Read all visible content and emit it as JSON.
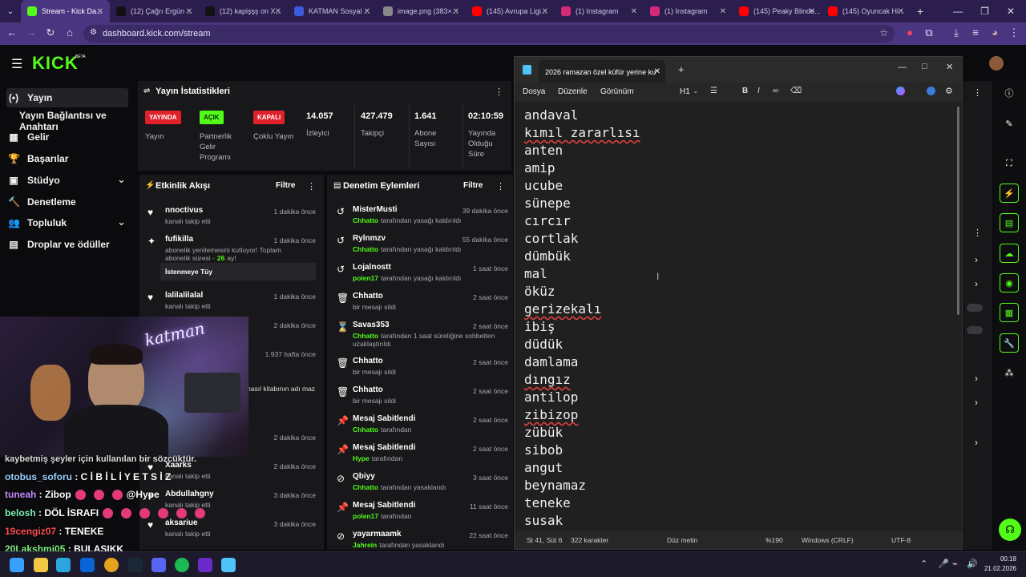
{
  "browser": {
    "tabs": [
      {
        "label": "Stream - Kick Da...",
        "fav": "#53fc18",
        "active": true
      },
      {
        "label": "(12) Çağrı Ergün ...",
        "fav": "#111111"
      },
      {
        "label": "(12) kapişşş on X...",
        "fav": "#111111"
      },
      {
        "label": "KATMAN Sosyal ...",
        "fav": "#3b5bdb"
      },
      {
        "label": "image.png (383×...",
        "fav": "#888888"
      },
      {
        "label": "(145) Avrupa Ligi...",
        "fav": "#ff0000"
      },
      {
        "label": "(1) Instagram",
        "fav": "#d62976"
      },
      {
        "label": "(1) Instagram",
        "fav": "#d62976"
      },
      {
        "label": "(145) Peaky Blinde...",
        "fav": "#ff0000"
      },
      {
        "label": "(145) Oyuncak Hi...",
        "fav": "#ff0000"
      }
    ],
    "new_tab": "+",
    "url": "dashboard.kick.com/stream"
  },
  "kick": {
    "logo": "KICK",
    "logo_beta": "BETA",
    "nav": [
      {
        "label": "Yayın",
        "icon": "(•)",
        "active": true
      },
      {
        "label": "Yayın Bağlantısı ve Anahtarı",
        "icon": ""
      },
      {
        "label": "Gelir",
        "icon": "▦"
      },
      {
        "label": "Başarılar",
        "icon": "🏆"
      },
      {
        "label": "Stüdyo",
        "icon": "▣",
        "chevron": "⌄"
      },
      {
        "label": "Denetleme",
        "icon": "🔨"
      },
      {
        "label": "Topluluk",
        "icon": "👥",
        "chevron": "⌄"
      },
      {
        "label": "Droplar ve ödüller",
        "icon": "▤"
      }
    ],
    "stats": {
      "title": "Yayın İstatistikleri",
      "badges": [
        {
          "value": "YAYINDA",
          "label": "Yayın",
          "color": "#e0202a"
        },
        {
          "value": "AÇIK",
          "label": "Partnerlik Gelir Programı",
          "color": "#53fc18"
        },
        {
          "value": "KAPALI",
          "label": "Çoklu Yayın",
          "color": "#e0202a"
        }
      ],
      "numbers": [
        {
          "value": "14.057",
          "label": "İzleyici"
        },
        {
          "value": "427.479",
          "label": "Takipçi"
        },
        {
          "value": "1.641",
          "label": "Abone Sayısı"
        },
        {
          "value": "02:10:59",
          "label": "Yayında Olduğu Süre"
        }
      ]
    },
    "activity": {
      "title": "Etkinlik Akışı",
      "filter": "Filtre",
      "items": [
        {
          "name": "nnoctivus",
          "sub": "kanalı takip etti",
          "time": "1 dakika önce"
        },
        {
          "name": "fufikilla",
          "sub": "abonelik yenilemesini kutluyor! Toplam abonelik süresi -",
          "months": "26",
          "months_suffix": "ay!",
          "message": "İstenmeye Tüy",
          "time": "1 dakika önce"
        },
        {
          "name": "lalilalilalal",
          "sub": "kanalı takip etti",
          "time": "1 dakika önce"
        },
        {
          "time": "2 dakika önce"
        },
        {
          "time": "1.937 hafta önce",
          "sub": "nasıl kitabının adı maz"
        },
        {
          "time": "2 dakika önce"
        },
        {
          "name": "Xaarks",
          "sub": "kanalı takip etti",
          "time": "2 dakika önce"
        },
        {
          "name": "Abdullahgny",
          "sub": "kanalı takip etti",
          "time": "3 dakika önce"
        },
        {
          "name": "aksariue",
          "sub": "kanalı takip etti",
          "time": "3 dakika önce"
        }
      ]
    },
    "moderation": {
      "title": "Denetim Eylemleri",
      "filter": "Filtre",
      "items": [
        {
          "icon": "↺",
          "name": "MisterMusti",
          "actor": "Chhatto",
          "sub": "tarafından yasağı kaldırıldı",
          "time": "39 dakika önce"
        },
        {
          "icon": "↺",
          "name": "Rylnmzv",
          "actor": "Chhatto",
          "sub": "tarafından yasağı kaldırıldı",
          "time": "55 dakika önce"
        },
        {
          "icon": "↺",
          "name": "Lojalnostt",
          "actor": "polen17",
          "sub": "tarafından yasağı kaldırıldı",
          "time": "1 saat önce"
        },
        {
          "icon": "🗑",
          "name": "Chhatto",
          "actor": "",
          "sub": "bir mesajı sildi",
          "time": "2 saat önce"
        },
        {
          "icon": "⌛",
          "name": "Savas353",
          "actor": "Chhatto",
          "sub": "tarafından 1 saat süreliğine sohbetten uzaklaştırıldı",
          "time": "2 saat önce"
        },
        {
          "icon": "🗑",
          "name": "Chhatto",
          "actor": "",
          "sub": "bir mesajı sildi",
          "time": "2 saat önce"
        },
        {
          "icon": "🗑",
          "name": "Chhatto",
          "actor": "",
          "sub": "bir mesajı sildi",
          "time": "2 saat önce"
        },
        {
          "icon": "📌",
          "name": "Mesaj Sabitlendi",
          "actor": "Chhatto",
          "sub": "tarafından",
          "time": "2 saat önce"
        },
        {
          "icon": "📌",
          "name": "Mesaj Sabitlendi",
          "actor": "Hype",
          "sub": "tarafından",
          "time": "2 saat önce"
        },
        {
          "icon": "⊘",
          "name": "Qbiyy",
          "actor": "Chhatto",
          "sub": "tarafından yasaklandı",
          "time": "3 saat önce"
        },
        {
          "icon": "📌",
          "name": "Mesaj Sabitlendi",
          "actor": "polen17",
          "sub": "tarafından",
          "time": "11 saat önce"
        },
        {
          "icon": "⊘",
          "name": "yayarmaamk",
          "actor": "Jahrein",
          "sub": "tarafından yasaklandı",
          "time": "22 saat önce"
        }
      ]
    },
    "chat_overlay": [
      {
        "user": "",
        "text": "kaybetmiş şeyler için kullanılan bir sözcüktür.",
        "color": "#ffffff"
      },
      {
        "user": "otobus_soforu",
        "text": "C İ B İ L İ Y E T S İ Z",
        "color": "#9ad0ff"
      },
      {
        "user": "tuneah",
        "text": "Zibop",
        "extra": "@Hype",
        "emotes": 3,
        "color": "#c58cff"
      },
      {
        "user": "belosh",
        "text": "DÖL İSRAFI",
        "emotes": 6,
        "color": "#7ef0b0"
      },
      {
        "user": "19cengiz07",
        "text": "TENEKE",
        "color": "#ff4d4d"
      },
      {
        "user": "20Lakshmi05",
        "text": "BULAŞIKK",
        "color": "#7ef07e"
      }
    ],
    "webcam_text": "katman"
  },
  "notepad": {
    "title": "2026 ramazan özel küfür yerine ku",
    "menu": [
      "Dosya",
      "Düzenle",
      "Görünüm"
    ],
    "heading": "H1",
    "lines": [
      "andaval",
      "kımıl zararlısı",
      "anten",
      "amip",
      "ucube",
      "sünepe",
      "cırcır",
      "cortlak",
      "dümbük",
      "mal",
      "öküz",
      "gerizekalı",
      "ibiş",
      "düdük",
      "damlama",
      "dıngız",
      "antilop",
      "zibizop",
      "zübük",
      "sibob",
      "angut",
      "beynamaz",
      "teneke",
      "susak"
    ],
    "status": {
      "pos": "St 41, Süt 6",
      "chars": "322 karakter",
      "format": "Düz metin",
      "zoom": "%190",
      "eol": "Windows (CRLF)",
      "enc": "UTF-8"
    }
  },
  "taskbar": {
    "time": "00:18",
    "date": "21.02.2026"
  }
}
